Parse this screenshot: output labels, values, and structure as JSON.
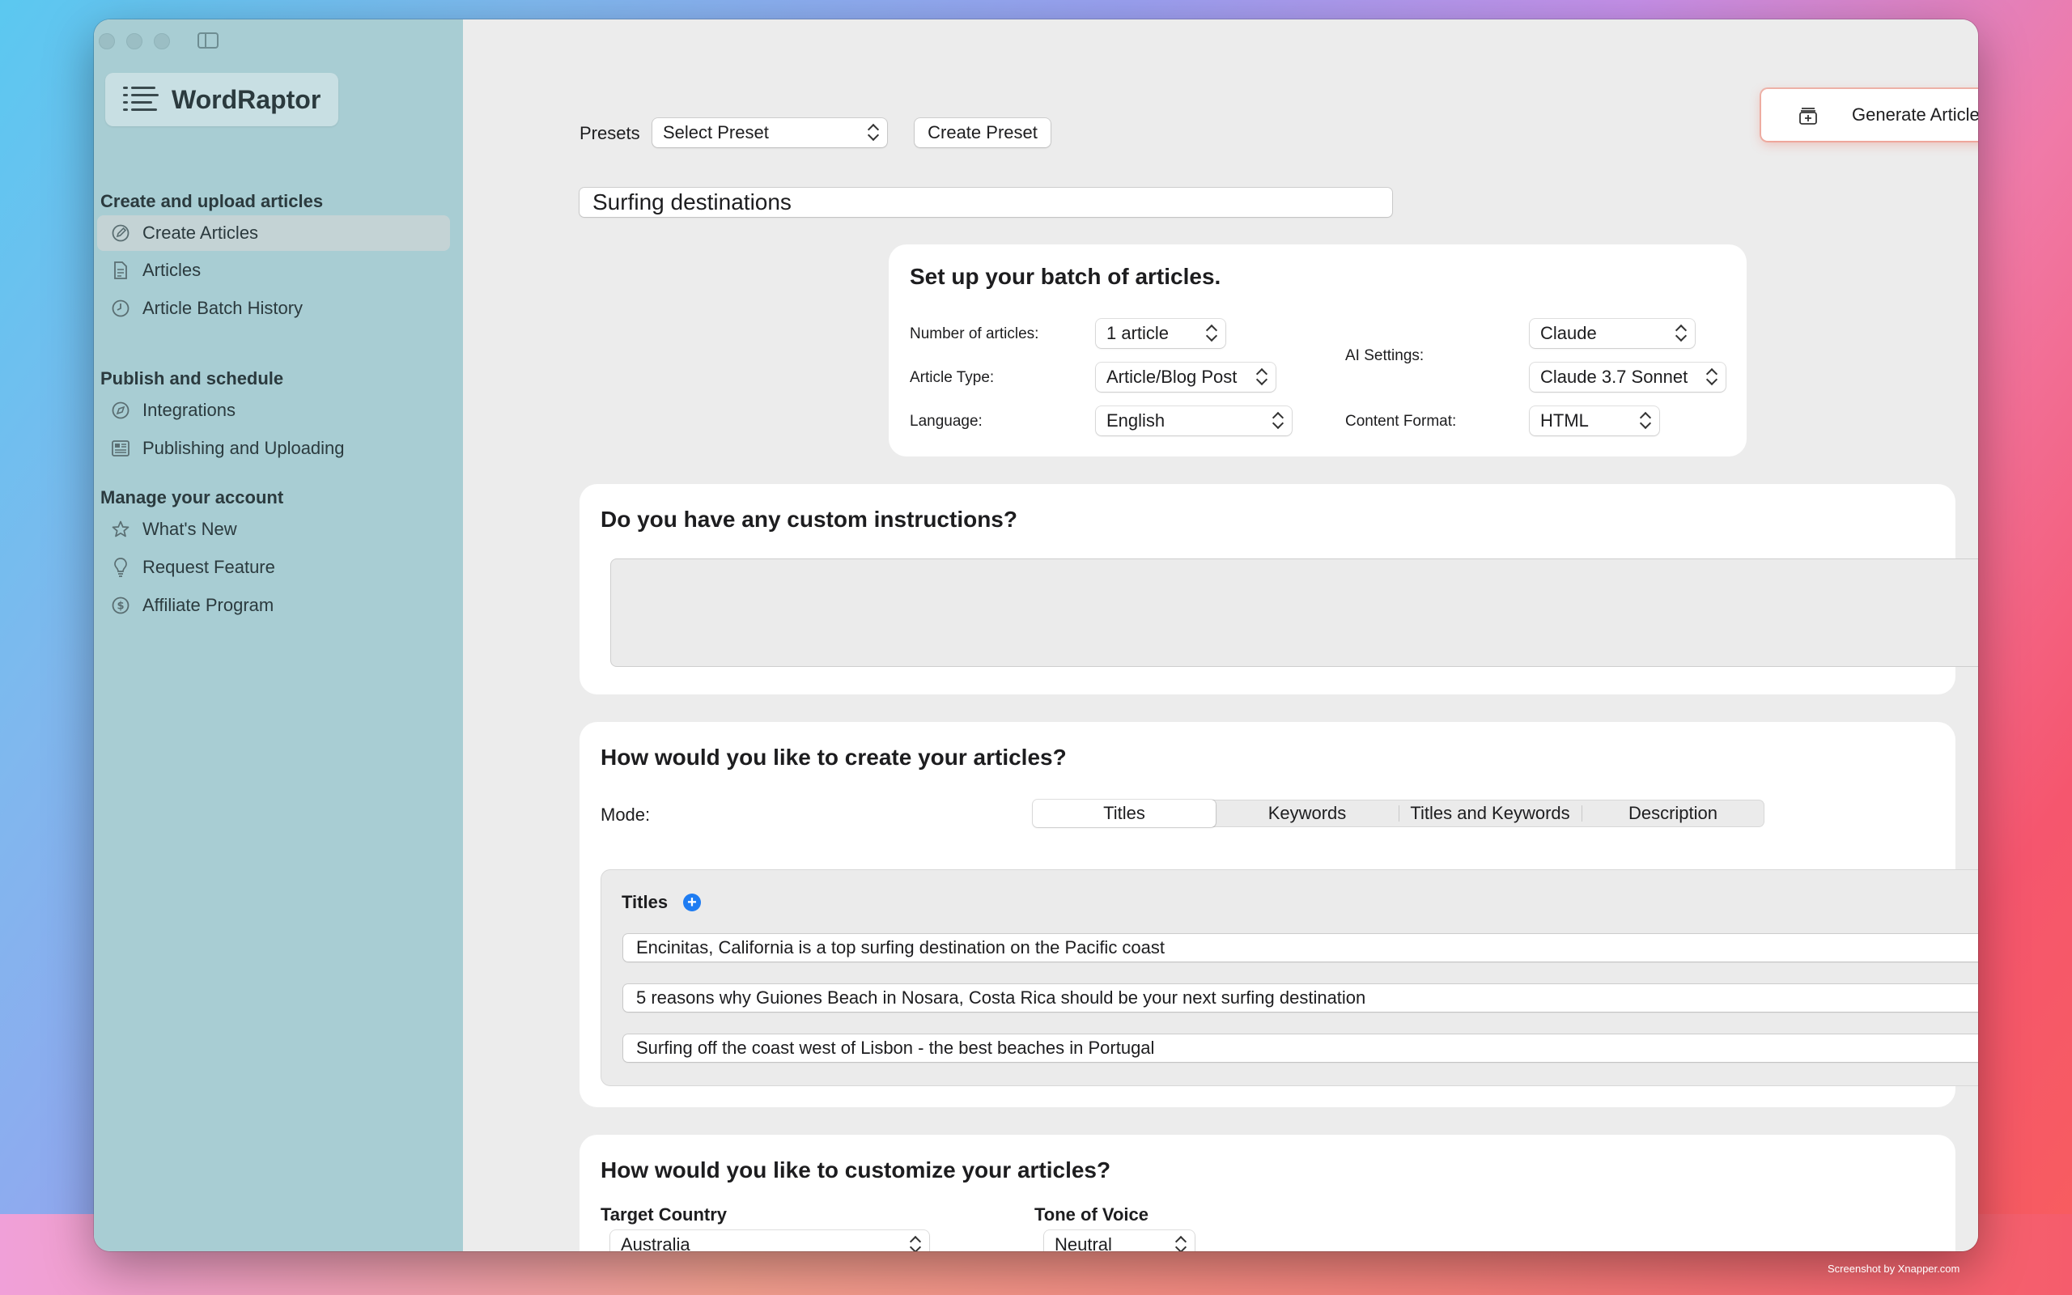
{
  "app": {
    "name": "WordRaptor"
  },
  "sidebar": {
    "sections": [
      {
        "title": "Create and upload articles"
      },
      {
        "title": "Publish and schedule"
      },
      {
        "title": "Manage your account"
      }
    ],
    "items": [
      {
        "label": "Create Articles",
        "icon": "edit-circle-icon",
        "active": true
      },
      {
        "label": "Articles",
        "icon": "document-icon"
      },
      {
        "label": "Article Batch History",
        "icon": "clock-icon"
      },
      {
        "label": "Integrations",
        "icon": "compass-icon"
      },
      {
        "label": "Publishing and Uploading",
        "icon": "newspaper-icon"
      },
      {
        "label": "What's New",
        "icon": "star-icon"
      },
      {
        "label": "Request Feature",
        "icon": "lightbulb-icon"
      },
      {
        "label": "Affiliate Program",
        "icon": "dollar-circle-icon"
      }
    ]
  },
  "toolbar": {
    "presets_label": "Presets",
    "preset_select": "Select Preset",
    "create_preset": "Create Preset",
    "generate": "Generate Articles"
  },
  "batch_name": "Surfing destinations",
  "setup": {
    "title": "Set up your batch of articles.",
    "num_articles_label": "Number of articles:",
    "num_articles_value": "1 article",
    "article_type_label": "Article Type:",
    "article_type_value": "Article/Blog Post",
    "language_label": "Language:",
    "language_value": "English",
    "ai_settings_label": "AI Settings:",
    "ai_provider_value": "Claude",
    "ai_model_value": "Claude 3.7 Sonnet",
    "content_format_label": "Content Format:",
    "content_format_value": "HTML"
  },
  "custom": {
    "title": "Do you have any custom instructions?",
    "value": ""
  },
  "create": {
    "title": "How would you like to create your articles?",
    "mode_label": "Mode:",
    "modes": [
      "Titles",
      "Keywords",
      "Titles and Keywords",
      "Description"
    ],
    "selected_mode": "Titles",
    "titles_label": "Titles",
    "titles": [
      "Encinitas, California is a top surfing destination on the Pacific coast",
      "5 reasons why Guiones Beach in Nosara, Costa Rica should be your next surfing destination",
      "Surfing off the coast west of Lisbon - the best beaches in Portugal"
    ]
  },
  "customize": {
    "title": "How would you like to customize your articles?",
    "target_country_label": "Target Country",
    "target_country_value": "Australia",
    "tone_label": "Tone of Voice",
    "tone_value": "Neutral"
  },
  "watermark": "Screenshot by Xnapper.com",
  "colors": {
    "sidebar": "#a8cdd3",
    "accent_blue": "#1e7cf2",
    "remove_red": "#e8322b"
  }
}
